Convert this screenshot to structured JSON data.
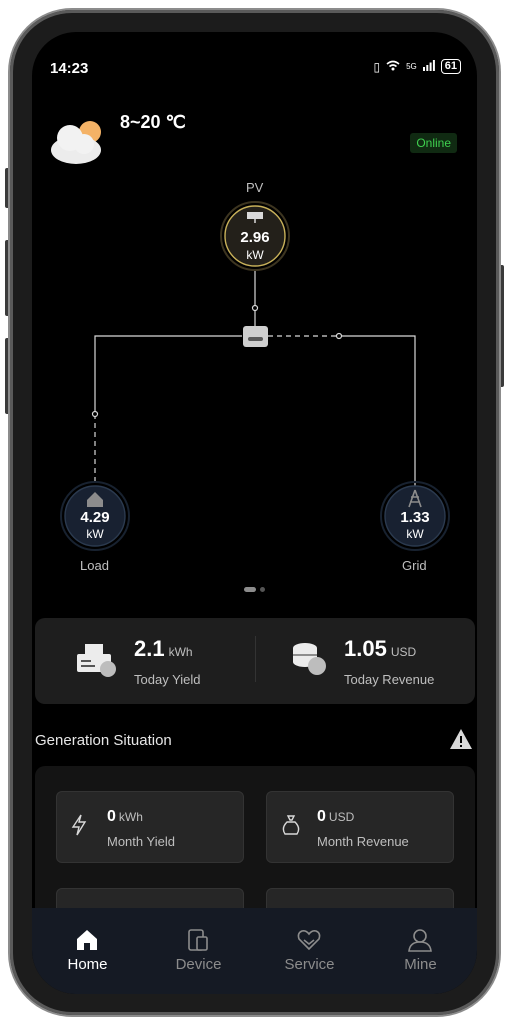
{
  "status_bar": {
    "time": "14:23",
    "signal": "5G",
    "battery": "61"
  },
  "weather": {
    "icon": "cloudy-sun-icon",
    "temperature": "8~20 ℃"
  },
  "connection_status": "Online",
  "flow": {
    "pv": {
      "label": "PV",
      "value": "2.96",
      "unit": "kW"
    },
    "load": {
      "label": "Load",
      "value": "4.29",
      "unit": "kW"
    },
    "grid": {
      "label": "Grid",
      "value": "1.33",
      "unit": "kW"
    }
  },
  "summary": {
    "today_yield": {
      "value": "2.1",
      "unit": "kWh",
      "label": "Today Yield"
    },
    "today_revenue": {
      "value": "1.05",
      "unit": "USD",
      "label": "Today Revenue"
    }
  },
  "generation": {
    "title": "Generation Situation",
    "month_yield": {
      "value": "0",
      "unit": "kWh",
      "label": "Month Yield"
    },
    "month_revenue": {
      "value": "0",
      "unit": "USD",
      "label": "Month Revenue"
    }
  },
  "tabs": [
    {
      "label": "Home",
      "icon": "home-icon",
      "active": true
    },
    {
      "label": "Device",
      "icon": "device-icon",
      "active": false
    },
    {
      "label": "Service",
      "icon": "service-icon",
      "active": false
    },
    {
      "label": "Mine",
      "icon": "user-icon",
      "active": false
    }
  ],
  "colors": {
    "online": "#3fcf4f",
    "pv_ring": "#c8b15a",
    "node_ring": "#2b3a4f",
    "background": "#000000"
  }
}
